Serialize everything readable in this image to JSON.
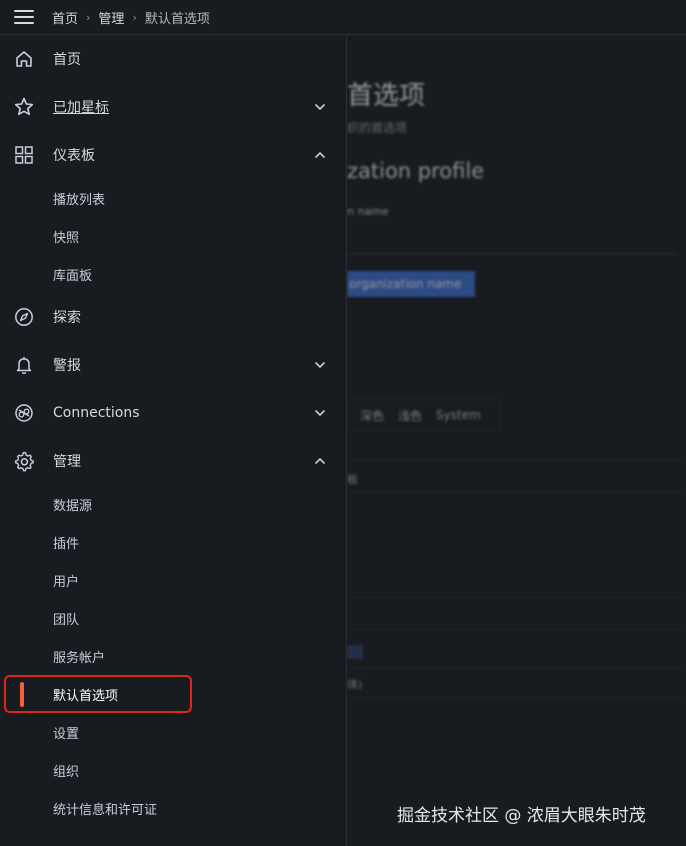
{
  "topbar": {
    "breadcrumb": [
      "首页",
      "管理",
      "默认首选项"
    ]
  },
  "sidebar": {
    "items": [
      {
        "label": "首页",
        "icon": "home-icon"
      },
      {
        "label": "已加星标",
        "icon": "star-icon",
        "chevron": "down"
      },
      {
        "label": "仪表板",
        "icon": "dashboard-grid-icon",
        "chevron": "up"
      },
      {
        "label": "探索",
        "icon": "compass-icon"
      },
      {
        "label": "警报",
        "icon": "bell-icon",
        "chevron": "down"
      },
      {
        "label": "Connections",
        "icon": "connections-icon",
        "chevron": "down"
      },
      {
        "label": "管理",
        "icon": "gear-icon",
        "chevron": "up"
      }
    ],
    "dashboard_children": [
      "播放列表",
      "快照",
      "库面板"
    ],
    "admin_children": [
      "数据源",
      "插件",
      "用户",
      "团队",
      "服务帐户",
      "默认首选项",
      "设置",
      "组织",
      "统计信息和许可证"
    ],
    "active_item": "默认首选项"
  },
  "main": {
    "title": "首选项",
    "subtitle": "织的首选项",
    "section_title": "zation profile",
    "name_label": "n name",
    "update_button": "organization name",
    "theme_options": [
      "深色",
      "浅色",
      "System"
    ],
    "small_texts": [
      "板",
      "体)"
    ]
  },
  "watermark": "掘金技术社区 @ 浓眉大眼朱时茂",
  "colors": {
    "accent": "#f55f3e",
    "highlight_border": "#e0251d",
    "primary_button": "#3d71d9"
  }
}
